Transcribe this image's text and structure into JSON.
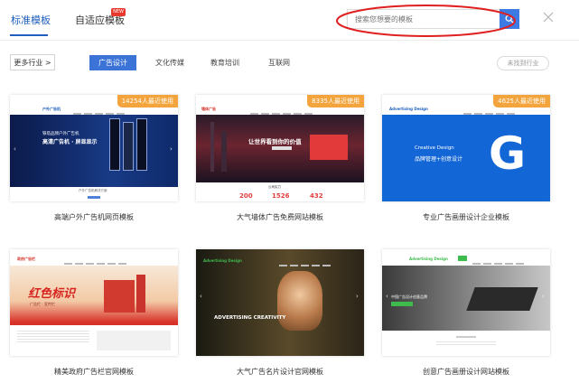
{
  "header": {
    "tabs": [
      {
        "label": "标准模板",
        "active": true
      },
      {
        "label": "自适应模板",
        "active": false,
        "badge": "NEW"
      }
    ],
    "search": {
      "placeholder": "搜索您想要的模板"
    },
    "accent_color": "#1f5fbd",
    "annotation_color": "#e02020"
  },
  "filter_bar": {
    "more_label": "更多行业 >",
    "categories": [
      {
        "label": "广告设计",
        "active": true
      },
      {
        "label": "文化传媒",
        "active": false
      },
      {
        "label": "教育培训",
        "active": false
      },
      {
        "label": "互联网",
        "active": false
      }
    ],
    "not_found_label": "未找到行业"
  },
  "cards": [
    {
      "title": "高端户外广告机网页模板",
      "usage": "14254人最近使用",
      "preview": {
        "logo": "户外广告机",
        "hero_line1": "铁塔品牌户外广告机",
        "hero_line2": "高清广告机 · 屏显显示",
        "subtitle": "户外广告机解决方案"
      }
    },
    {
      "title": "大气墙体广告免费网站模板",
      "usage": "8335人最近使用",
      "preview": {
        "logo": "墙体广告",
        "hero_line1": "让世界看到你的价值",
        "section": "公司实力",
        "stats": [
          "200",
          "1526",
          "432"
        ]
      }
    },
    {
      "title": "专业广告画册设计企业模板",
      "usage": "4625人最近使用",
      "preview": {
        "logo": "Advertising Design",
        "hero_line1": "Creative Design",
        "hero_line2": "品牌管理+创意设计",
        "mark": "G"
      }
    },
    {
      "title": "精美政府广告栏官网模板",
      "usage": "",
      "preview": {
        "logo": "政府广告栏",
        "hero_line1": "红色标识",
        "hero_line2": "广告栏 · 宣传栏"
      }
    },
    {
      "title": "大气广告名片设计官网模板",
      "usage": "",
      "preview": {
        "logo": "Advertising Design",
        "hero_line1": "ADVERTISING CREATIVITY"
      }
    },
    {
      "title": "创意广告画册设计网站模板",
      "usage": "",
      "preview": {
        "logo": "Advertising Design",
        "hero_line1": "中国广告设计创意品牌"
      }
    }
  ]
}
